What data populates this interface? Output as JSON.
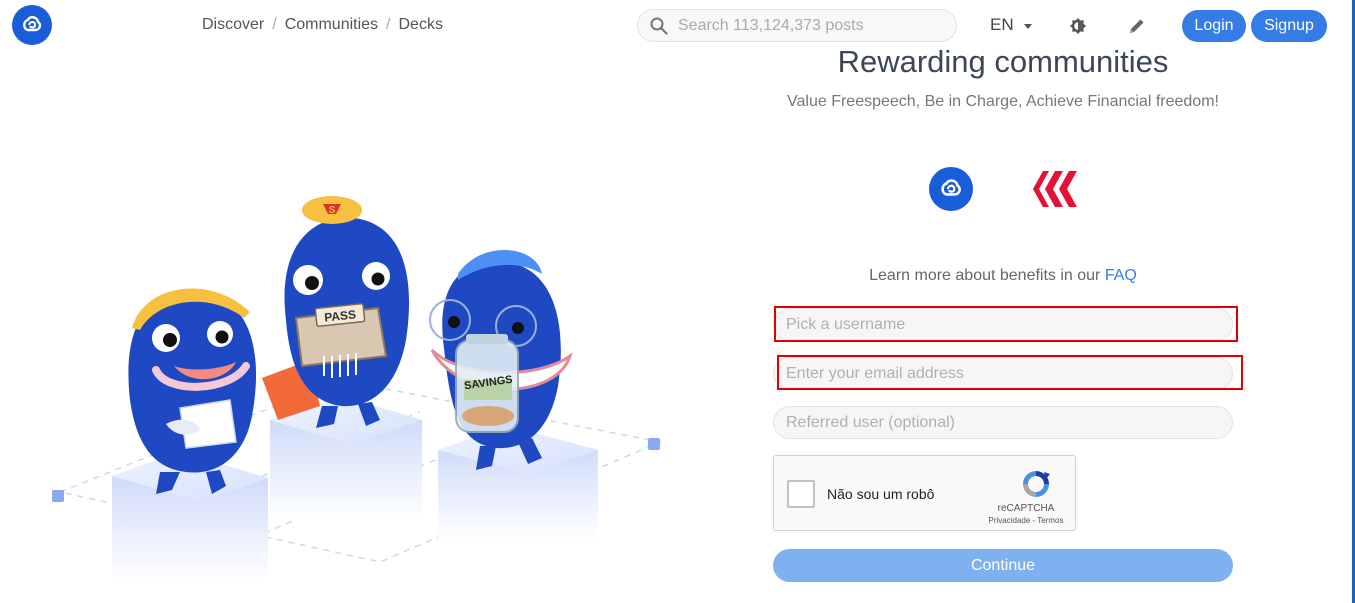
{
  "header": {
    "nav": [
      "Discover",
      "Communities",
      "Decks"
    ],
    "nav_separator": "/",
    "search_placeholder": "Search 113,124,373 posts",
    "language": "EN",
    "login_label": "Login",
    "signup_label": "Signup"
  },
  "illustration": {
    "cap_badge": "S",
    "box_label": "PASS",
    "jar_label": "SAVINGS"
  },
  "main": {
    "heading": "Rewarding communities",
    "subheading": "Value Freespeech, Be in Charge, Achieve Financial freedom!",
    "faq_prefix": "Learn more about benefits in our",
    "faq_link": "FAQ",
    "username_placeholder": "Pick a username",
    "email_placeholder": "Enter your email address",
    "referral_placeholder": "Referred user (optional)",
    "continue_label": "Continue"
  },
  "captcha": {
    "label": "Não sou um robô",
    "brand": "reCAPTCHA",
    "links": "Privacidade - Termos"
  },
  "colors": {
    "accent": "#357ce6",
    "brand_blue": "#1a5dd8",
    "hive_red": "#e31337",
    "highlight": "#e00000"
  },
  "icons": [
    "ecency-logo-icon",
    "search-icon",
    "theme-toggle-icon",
    "pencil-icon",
    "hive-logo-icon",
    "recaptcha-icon"
  ]
}
